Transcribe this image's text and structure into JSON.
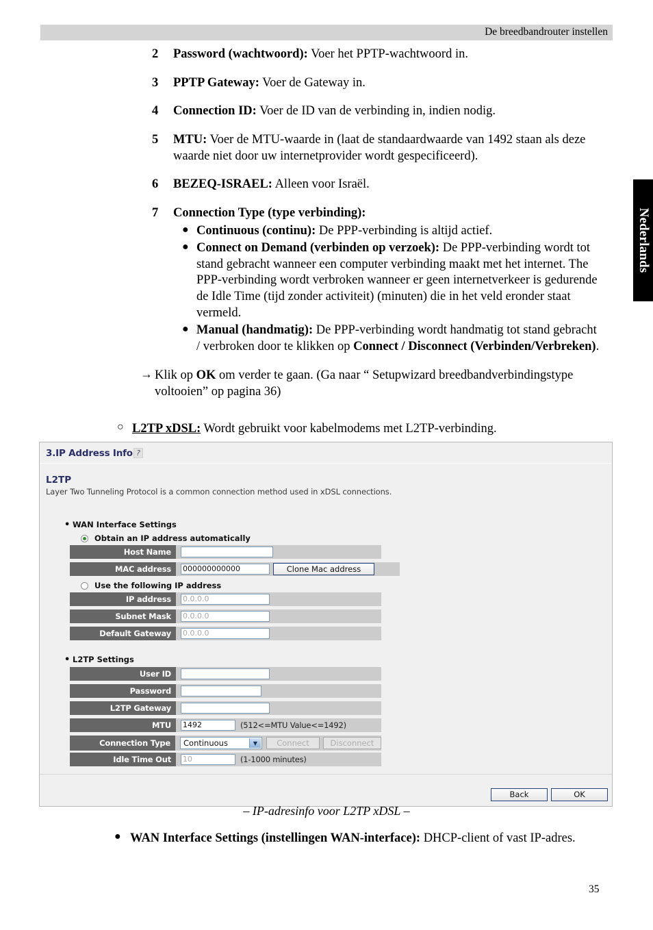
{
  "header": {
    "running_title": "De breedbandrouter instellen"
  },
  "sidetab": {
    "label": "Nederlands"
  },
  "steps": [
    {
      "num": "2",
      "bold": "Password (wachtwoord):",
      "text": " Voer het PPTP-wachtwoord in."
    },
    {
      "num": "3",
      "bold": "PPTP Gateway:",
      "text": " Voer de Gateway in."
    },
    {
      "num": "4",
      "bold": "Connection ID:",
      "text": " Voer de ID van de verbinding in, indien nodig."
    },
    {
      "num": "5",
      "bold": "MTU:",
      "text": " Voer de MTU-waarde in (laat de standaardwaarde van 1492 staan als deze waarde niet door uw internetprovider wordt gespecificeerd)."
    },
    {
      "num": "6",
      "bold": "BEZEQ-ISRAEL:",
      "text": " Alleen voor Israël."
    },
    {
      "num": "7",
      "bold": "Connection Type (type verbinding):",
      "text": ""
    }
  ],
  "sub_bullets": [
    {
      "marker": "●",
      "bold": "Continuous (continu):",
      "text": " De PPP-verbinding is altijd actief."
    },
    {
      "marker": "●",
      "bold": "Connect on Demand (verbinden op verzoek):",
      "text": " De PPP-verbinding wordt tot stand gebracht wanneer een computer verbinding maakt met het internet. The PPP-verbinding wordt verbroken wanneer er geen internetverkeer is gedurende de Idle Time (tijd zonder activiteit) (minuten) die in het veld eronder staat vermeld."
    },
    {
      "marker": "●",
      "bold": "Manual (handmatig):",
      "text_1": " De PPP-verbinding wordt handmatig tot stand gebracht / verbroken door te klikken op ",
      "bold_2": "Connect / Disconnect (Verbinden/Verbreken)",
      "text_2": "."
    }
  ],
  "arrow_para": {
    "marker": "→",
    "text_1": "Klik op ",
    "bold": "OK",
    "text_2": " om verder te gaan. (Ga naar “ Setupwizard breedbandverbindingstype voltooien” op pagina 36)"
  },
  "circle_para": {
    "marker": "○",
    "heading": "L2TP xDSL:",
    "text": " Wordt gebruikt voor kabelmodems met L2TP-verbinding."
  },
  "screenshot": {
    "title": "3.IP Address Info",
    "help_icon": "?",
    "section_title": "L2TP",
    "section_desc": "Layer Two Tunneling Protocol is a common connection method used in xDSL connections.",
    "wan_group_label": "WAN Interface Settings",
    "radio_auto": "Obtain an IP address automatically",
    "radio_manual": "Use the following IP address",
    "fields_auto": [
      {
        "label": "Host Name",
        "value": ""
      },
      {
        "label": "MAC address",
        "value": "000000000000"
      }
    ],
    "clone_button": "Clone Mac address",
    "fields_manual": [
      {
        "label": "IP address",
        "value": "0.0.0.0"
      },
      {
        "label": "Subnet Mask",
        "value": "0.0.0.0"
      },
      {
        "label": "Default Gateway",
        "value": "0.0.0.0"
      }
    ],
    "l2tp_group_label": "L2TP Settings",
    "fields_l2tp": [
      {
        "label": "User ID",
        "value": ""
      },
      {
        "label": "Password",
        "value": ""
      },
      {
        "label": "L2TP Gateway",
        "value": ""
      }
    ],
    "mtu_label": "MTU",
    "mtu_value": "1492",
    "mtu_hint": "(512<=MTU Value<=1492)",
    "conn_type_label": "Connection Type",
    "conn_type_value": "Continuous",
    "connect_button": "Connect",
    "disconnect_button": "Disconnect",
    "idle_label": "Idle Time Out",
    "idle_value": "10",
    "idle_hint": "(1-1000 minutes)",
    "back_button": "Back",
    "ok_button": "OK",
    "colors": {
      "heading": "#2b2f68",
      "label_bg": "#666666",
      "row_bg": "#cccccc",
      "panel_bg": "#f0f0f0"
    }
  },
  "caption": "– IP-adresinfo voor L2TP xDSL –",
  "tail_bullet": {
    "marker": "●",
    "bold": "WAN Interface Settings (instellingen WAN-interface):",
    "text": " DHCP-client of vast IP-adres."
  },
  "page_number": "35"
}
